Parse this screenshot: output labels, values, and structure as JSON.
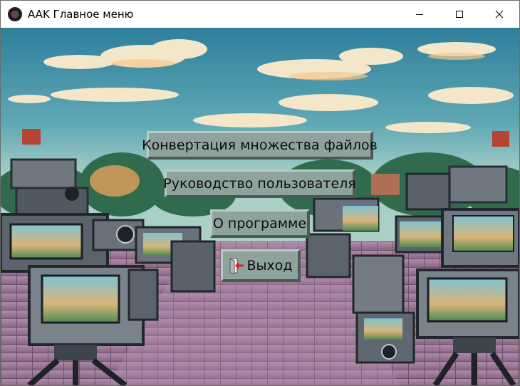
{
  "window": {
    "title": "AAK Главное меню",
    "icon": "app-logo-icon",
    "controls": [
      "minimize-icon",
      "maximize-icon",
      "close-icon"
    ]
  },
  "background": {
    "description_icon": "pixel-art-cameras-background"
  },
  "menu": {
    "convert_label": "Конвертация множества файлов",
    "guide_label": "Руководство пользователя",
    "about_label": "О программе",
    "exit_label": "Выход",
    "exit_icon": "exit-door-icon"
  },
  "colors": {
    "button_face": "#8fa39d",
    "button_highlight": "#b9cbc5",
    "button_shadow": "#4c5a56",
    "sky": "#3f8fa6",
    "pavement": "#9a7393"
  }
}
